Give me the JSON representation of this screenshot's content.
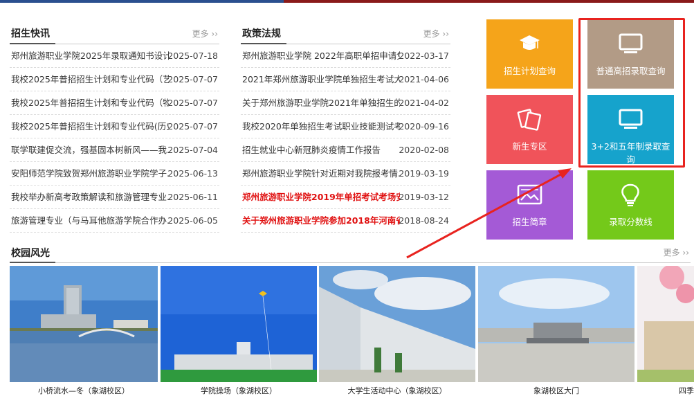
{
  "news": {
    "title": "招生快讯",
    "more": "更多 ››",
    "items": [
      {
        "title": "郑州旅游职业学院2025年录取通知书设计...",
        "date": "2025-07-18"
      },
      {
        "title": "我校2025年普招招生计划和专业代码（艺...",
        "date": "2025-07-07"
      },
      {
        "title": "我校2025年普招招生计划和专业代码（物...",
        "date": "2025-07-07"
      },
      {
        "title": "我校2025年普招招生计划和专业代码(历史...",
        "date": "2025-07-07"
      },
      {
        "title": "联学联建促交流，强基固本树新风——我...",
        "date": "2025-07-04"
      },
      {
        "title": "安阳师范学院致贺郑州旅游职业学院学子...",
        "date": "2025-06-13"
      },
      {
        "title": "我校举办新高考政策解读和旅游管理专业...",
        "date": "2025-06-11"
      },
      {
        "title": "旅游管理专业（与马耳他旅游学院合作办...",
        "date": "2025-06-05"
      }
    ]
  },
  "policy": {
    "title": "政策法规",
    "more": "更多 ››",
    "items": [
      {
        "title": "郑州旅游职业学院 2022年高职单招申请免...",
        "date": "2022-03-17"
      },
      {
        "title": "2021年郑州旅游职业学院单独招生考试大...",
        "date": "2021-04-06"
      },
      {
        "title": "关于郑州旅游职业学院2021年单独招生的...",
        "date": "2021-04-02"
      },
      {
        "title": "我校2020年单独招生考试职业技能测试考...",
        "date": "2020-09-16"
      },
      {
        "title": "招生就业中心新冠肺炎疫情工作报告",
        "date": "2020-02-08"
      },
      {
        "title": "郑州旅游职业学院针对近期对我院报考情...",
        "date": "2019-03-19"
      },
      {
        "title": "郑州旅游职业学院2019年单招考试考场安...",
        "date": "2019-03-12"
      },
      {
        "title": "关于郑州旅游职业学院参加2018年河南省...",
        "date": "2018-08-24"
      }
    ]
  },
  "tiles": [
    {
      "label": "招生计划查询",
      "icon": "graduation-cap-icon",
      "color": "#f5a41a"
    },
    {
      "label": "普通高招录取查询",
      "icon": "monitor-icon",
      "color": "#b29b86"
    },
    {
      "label": "新生专区",
      "icon": "photos-icon",
      "color": "#f0535a"
    },
    {
      "label": "3+2和五年制录取查询",
      "icon": "monitor-icon",
      "color": "#16a3cc"
    },
    {
      "label": "招生简章",
      "icon": "picture-icon",
      "color": "#a45ad6"
    },
    {
      "label": "录取分数线",
      "icon": "lightbulb-icon",
      "color": "#74c91a"
    }
  ],
  "campus": {
    "title": "校园风光",
    "more": "更多 ››",
    "photos": [
      {
        "caption": "小桥流水—冬（象湖校区）"
      },
      {
        "caption": "学院操场（象湖校区）"
      },
      {
        "caption": "大学生活动中心（象湖校区）"
      },
      {
        "caption": "象湖校区大门"
      },
      {
        "caption": "四季"
      }
    ]
  },
  "colors": {
    "highlight": "#e01010",
    "annotation": "#e8231f"
  }
}
